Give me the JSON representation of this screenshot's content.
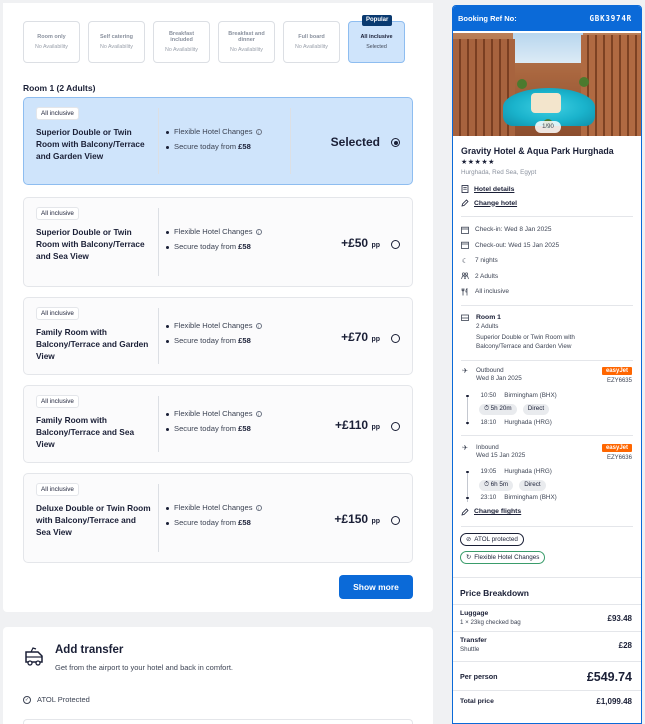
{
  "board_options": [
    {
      "name": "Room only",
      "availability": "No Availability"
    },
    {
      "name": "Self catering",
      "availability": "No Availability"
    },
    {
      "name": "Breakfast included",
      "availability": "No Availability"
    },
    {
      "name": "Breakfast and dinner",
      "availability": "No Availability"
    },
    {
      "name": "Full board",
      "availability": "No Availability"
    },
    {
      "name": "All inclusive",
      "availability": "Selected",
      "badge": "Popular"
    }
  ],
  "room_heading": "Room 1 (2 Adults)",
  "feature_labels": {
    "flexible": "Flexible Hotel Changes",
    "secure_prefix": "Secure today from ",
    "secure_amount": "£58",
    "per_person": "pp"
  },
  "rooms": [
    {
      "board": "All inclusive",
      "name": "Superior Double or Twin Room with Balcony/Terrace and Garden View",
      "price": "Selected",
      "price_suffix": ""
    },
    {
      "board": "All inclusive",
      "name": "Superior Double or Twin Room with Balcony/Terrace and Sea View",
      "price": "+£50",
      "price_suffix": "pp"
    },
    {
      "board": "All inclusive",
      "name": "Family Room with Balcony/Terrace and Garden View",
      "price": "+£70",
      "price_suffix": "pp"
    },
    {
      "board": "All inclusive",
      "name": "Family Room with Balcony/Terrace and Sea View",
      "price": "+£110",
      "price_suffix": "pp"
    },
    {
      "board": "All inclusive",
      "name": "Deluxe Double or Twin Room with Balcony/Terrace and Sea View",
      "price": "+£150",
      "price_suffix": "pp"
    }
  ],
  "show_more_label": "Show more",
  "transfer": {
    "title": "Add transfer",
    "subtitle": "Get from the airport to your hotel and back in comfort.",
    "atol": "ATOL Protected"
  },
  "booking": {
    "ref_label": "Booking Ref No:",
    "ref_value": "GBK3974R",
    "image_counter": "1/90",
    "hotel_name": "Gravity Hotel & Aqua Park Hurghada",
    "stars": "★★★★★",
    "location": "Hurghada, Red Sea, Egypt",
    "hotel_details_link": "Hotel details",
    "change_hotel_link": "Change hotel",
    "check_in": "Check-in: Wed 8 Jan 2025",
    "check_out": "Check-out: Wed 15 Jan 2025",
    "nights": "7 nights",
    "guests": "2 Adults",
    "board": "All inclusive",
    "room_title": "Room 1",
    "room_guests": "2 Adults",
    "room_desc": "Superior Double or Twin Room with Balcony/Terrace and Garden View",
    "outbound": {
      "label": "Outbound",
      "date": "Wed 8 Jan 2025",
      "airline": "easyJet",
      "code": "EZY6635",
      "dep_time": "10:50",
      "dep_place": "Birmingham (BHX)",
      "duration": "5h 20m",
      "stops": "Direct",
      "arr_time": "18:10",
      "arr_place": "Hurghada (HRG)"
    },
    "inbound": {
      "label": "Inbound",
      "date": "Wed 15 Jan 2025",
      "airline": "easyJet",
      "code": "EZY6636",
      "dep_time": "19:05",
      "dep_place": "Hurghada (HRG)",
      "duration": "6h 5m",
      "stops": "Direct",
      "arr_time": "23:10",
      "arr_place": "Birmingham (BHX)"
    },
    "change_flights_link": "Change flights",
    "atol_badge": "ATOL protected",
    "flex_badge": "Flexible Hotel Changes"
  },
  "price_breakdown": {
    "title": "Price Breakdown",
    "luggage_label": "Luggage",
    "luggage_sub": "1 × 23kg checked bag",
    "luggage_price": "£93.48",
    "transfer_label": "Transfer",
    "transfer_sub": "Shuttle",
    "transfer_price": "£28",
    "per_person_label": "Per person",
    "per_person_price": "£549.74",
    "total_label": "Total price",
    "total_price": "£1,099.48"
  },
  "colors": {
    "accent": "#0b6ad8",
    "selected_bg": "#cfe4fb",
    "easyjet": "#ff6600"
  }
}
